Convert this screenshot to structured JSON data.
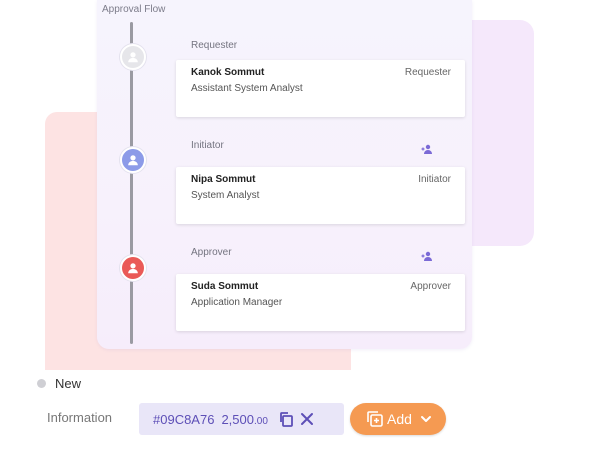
{
  "panel": {
    "title": "Approval Flow"
  },
  "steps": [
    {
      "label": "Requester",
      "person": {
        "name": "Kanok Sommut",
        "title": "Assistant System Analyst",
        "role": "Requester"
      }
    },
    {
      "label": "Initiator",
      "person": {
        "name": "Nipa Sommut",
        "title": "System Analyst",
        "role": "Initiator"
      }
    },
    {
      "label": "Approver",
      "person": {
        "name": "Suda Sommut",
        "title": "Application Manager",
        "role": "Approver"
      }
    }
  ],
  "status": {
    "text": "New"
  },
  "information": {
    "label": "Information",
    "code": "#09C8A76",
    "amount": "2,500",
    "amount_decimal": ".00"
  },
  "add_button": {
    "label": "Add"
  },
  "colors": {
    "accent_purple": "#5d4fb7",
    "add_orange": "#f59a52",
    "avatar_requester": "#e6e6ea",
    "avatar_initiator": "#8c9be8",
    "avatar_approver": "#ea5a57"
  },
  "icons": {
    "avatar": "person-icon",
    "add_approver": "add-person-icon",
    "copy": "copy-icon",
    "close": "close-icon",
    "add": "add-document-icon",
    "dropdown": "chevron-down-icon"
  }
}
